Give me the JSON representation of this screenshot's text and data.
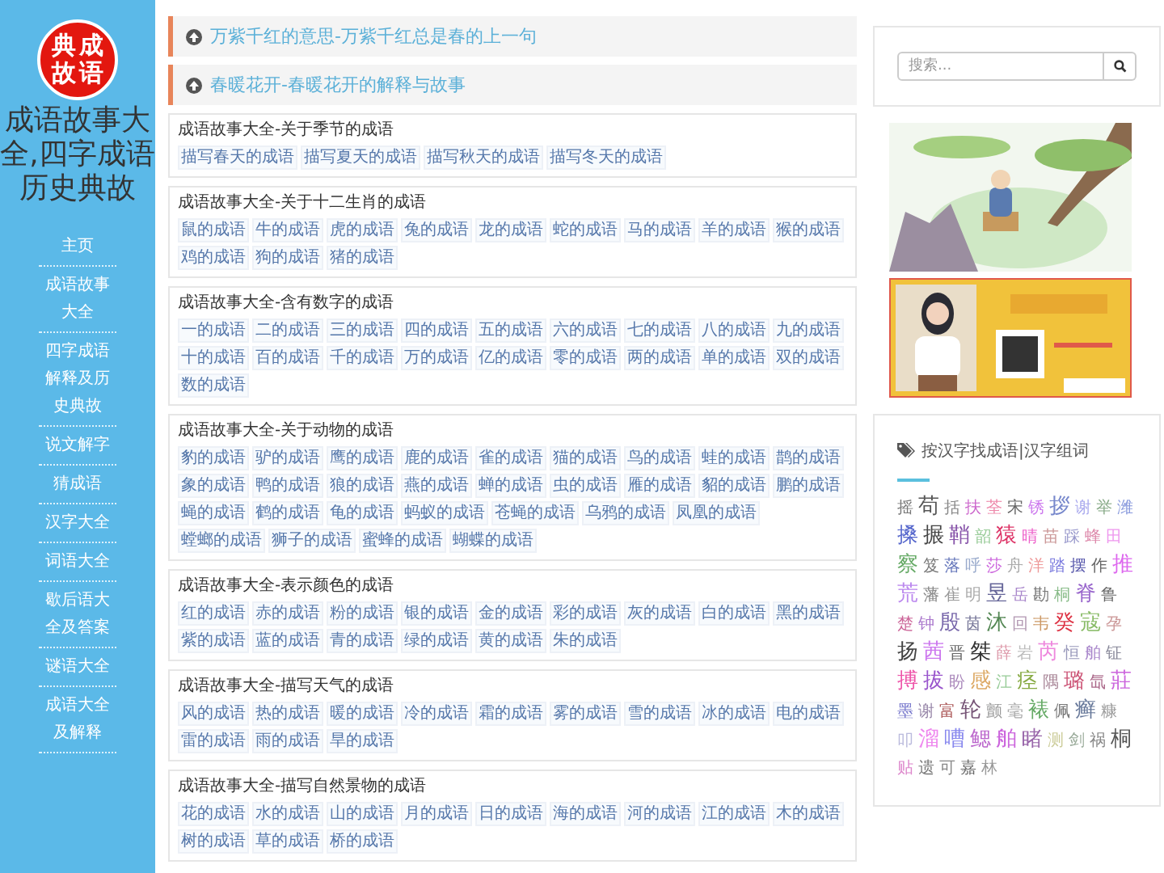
{
  "logo": {
    "chars": [
      "典",
      "成",
      "故",
      "语"
    ]
  },
  "site_title": "成语故事大全,四字成语历史典故",
  "nav": [
    "主页",
    "成语故事大全",
    "四字成语解释及历史典故",
    "说文解字",
    "猜成语",
    "汉字大全",
    "词语大全",
    "歇后语大全及答案",
    "谜语大全",
    "成语大全及解释"
  ],
  "featured": [
    "万紫千红的意思-万紫千红总是春的上一句",
    "春暖花开-春暖花开的解释与故事"
  ],
  "sections": [
    {
      "title": "成语故事大全-关于季节的成语",
      "tags": [
        "描写春天的成语",
        "描写夏天的成语",
        "描写秋天的成语",
        "描写冬天的成语"
      ]
    },
    {
      "title": "成语故事大全-关于十二生肖的成语",
      "tags": [
        "鼠的成语",
        "牛的成语",
        "虎的成语",
        "兔的成语",
        "龙的成语",
        "蛇的成语",
        "马的成语",
        "羊的成语",
        "猴的成语",
        "鸡的成语",
        "狗的成语",
        "猪的成语"
      ]
    },
    {
      "title": "成语故事大全-含有数字的成语",
      "tags": [
        "一的成语",
        "二的成语",
        "三的成语",
        "四的成语",
        "五的成语",
        "六的成语",
        "七的成语",
        "八的成语",
        "九的成语",
        "十的成语",
        "百的成语",
        "千的成语",
        "万的成语",
        "亿的成语",
        "零的成语",
        "两的成语",
        "单的成语",
        "双的成语",
        "数的成语"
      ]
    },
    {
      "title": "成语故事大全-关于动物的成语",
      "tags": [
        "豹的成语",
        "驴的成语",
        "鹰的成语",
        "鹿的成语",
        "雀的成语",
        "猫的成语",
        "鸟的成语",
        "蛙的成语",
        "鹊的成语",
        "象的成语",
        "鸭的成语",
        "狼的成语",
        "燕的成语",
        "蝉的成语",
        "虫的成语",
        "雁的成语",
        "貂的成语",
        "鹏的成语",
        "蝇的成语",
        "鹤的成语",
        "龟的成语",
        "蚂蚁的成语",
        "苍蝇的成语",
        "乌鸦的成语",
        "凤凰的成语",
        "螳螂的成语",
        "狮子的成语",
        "蜜蜂的成语",
        "蝴蝶的成语"
      ]
    },
    {
      "title": "成语故事大全-表示颜色的成语",
      "tags": [
        "红的成语",
        "赤的成语",
        "粉的成语",
        "银的成语",
        "金的成语",
        "彩的成语",
        "灰的成语",
        "白的成语",
        "黑的成语",
        "紫的成语",
        "蓝的成语",
        "青的成语",
        "绿的成语",
        "黄的成语",
        "朱的成语"
      ]
    },
    {
      "title": "成语故事大全-描写天气的成语",
      "tags": [
        "风的成语",
        "热的成语",
        "暖的成语",
        "冷的成语",
        "霜的成语",
        "雾的成语",
        "雪的成语",
        "冰的成语",
        "电的成语",
        "雷的成语",
        "雨的成语",
        "旱的成语"
      ]
    },
    {
      "title": "成语故事大全-描写自然景物的成语",
      "tags": [
        "花的成语",
        "水的成语",
        "山的成语",
        "月的成语",
        "日的成语",
        "海的成语",
        "河的成语",
        "江的成语",
        "木的成语",
        "树的成语",
        "草的成语",
        "桥的成语"
      ]
    }
  ],
  "search": {
    "placeholder": "搜索..."
  },
  "cloud": {
    "title": "按汉字找成语|汉字组词",
    "tags": [
      {
        "text": "摇",
        "color": "#777777",
        "kind": "small"
      },
      {
        "text": "苟",
        "color": "#555555",
        "kind": "big"
      },
      {
        "text": "括",
        "color": "#888888",
        "kind": "small"
      },
      {
        "text": "扶",
        "color": "#cc66cc",
        "kind": "small"
      },
      {
        "text": "荃",
        "color": "#ee88aa",
        "kind": "small"
      },
      {
        "text": "宋",
        "color": "#666666",
        "kind": "small"
      },
      {
        "text": "锈",
        "color": "#cc77ee",
        "kind": "small"
      },
      {
        "text": "拶",
        "color": "#7788cc",
        "kind": "big"
      },
      {
        "text": "谢",
        "color": "#aaaaee",
        "kind": "small"
      },
      {
        "text": "举",
        "color": "#88aa88",
        "kind": "small"
      },
      {
        "text": "潍",
        "color": "#8899dd",
        "kind": "small"
      },
      {
        "text": "搡",
        "color": "#5566cc",
        "kind": "big"
      },
      {
        "text": "搌",
        "color": "#444444",
        "kind": "big"
      },
      {
        "text": "鞘",
        "color": "#8855aa",
        "kind": "big"
      },
      {
        "text": "韶",
        "color": "#99cc99",
        "kind": "small"
      },
      {
        "text": "猿",
        "color": "#dd3366",
        "kind": "big"
      },
      {
        "text": "晴",
        "color": "#ee66cc",
        "kind": "small"
      },
      {
        "text": "苗",
        "color": "#cc9999",
        "kind": "small"
      },
      {
        "text": "踩",
        "color": "#9999cc",
        "kind": "small"
      },
      {
        "text": "蜂",
        "color": "#dd88aa",
        "kind": "small"
      },
      {
        "text": "田",
        "color": "#ee99ee",
        "kind": "small"
      },
      {
        "text": "察",
        "color": "#66aa66",
        "kind": "big"
      },
      {
        "text": "笈",
        "color": "#777777",
        "kind": "small"
      },
      {
        "text": "落",
        "color": "#6677bb",
        "kind": "small"
      },
      {
        "text": "呼",
        "color": "#99aacc",
        "kind": "small"
      },
      {
        "text": "莎",
        "color": "#cc66dd",
        "kind": "small"
      },
      {
        "text": "舟",
        "color": "#aaaaaa",
        "kind": "small"
      },
      {
        "text": "洋",
        "color": "#ee9999",
        "kind": "small"
      },
      {
        "text": "踏",
        "color": "#7777dd",
        "kind": "small"
      },
      {
        "text": "摆",
        "color": "#5555aa",
        "kind": "small"
      },
      {
        "text": "作",
        "color": "#666666",
        "kind": "small"
      },
      {
        "text": "推",
        "color": "#dd66ee",
        "kind": "big"
      },
      {
        "text": "荒",
        "color": "#bb88ee",
        "kind": "big"
      },
      {
        "text": "藩",
        "color": "#888888",
        "kind": "small"
      },
      {
        "text": "崔",
        "color": "#999999",
        "kind": "small"
      },
      {
        "text": "明",
        "color": "#aaaaaa",
        "kind": "small"
      },
      {
        "text": "昱",
        "color": "#666699",
        "kind": "big"
      },
      {
        "text": "岳",
        "color": "#aa88cc",
        "kind": "small"
      },
      {
        "text": "勘",
        "color": "#777777",
        "kind": "small"
      },
      {
        "text": "桐",
        "color": "#88bb88",
        "kind": "small"
      },
      {
        "text": "脊",
        "color": "#9966cc",
        "kind": "big"
      },
      {
        "text": "鲁",
        "color": "#666666",
        "kind": "small"
      },
      {
        "text": "楚",
        "color": "#cc6699",
        "kind": "small"
      },
      {
        "text": "钟",
        "color": "#aa77cc",
        "kind": "small"
      },
      {
        "text": "殷",
        "color": "#7766aa",
        "kind": "big"
      },
      {
        "text": "茵",
        "color": "#777799",
        "kind": "small"
      },
      {
        "text": "沐",
        "color": "#558855",
        "kind": "big"
      },
      {
        "text": "回",
        "color": "#b399b3",
        "kind": "small"
      },
      {
        "text": "韦",
        "color": "#cc9966",
        "kind": "small"
      },
      {
        "text": "癸",
        "color": "#dd3344",
        "kind": "big"
      },
      {
        "text": "寇",
        "color": "#88bb66",
        "kind": "big"
      },
      {
        "text": "孕",
        "color": "#cc9999",
        "kind": "small"
      },
      {
        "text": "扬",
        "color": "#444444",
        "kind": "big"
      },
      {
        "text": "茜",
        "color": "#cc77ee",
        "kind": "big"
      },
      {
        "text": "晋",
        "color": "#666666",
        "kind": "small"
      },
      {
        "text": "桀",
        "color": "#333333",
        "kind": "big"
      },
      {
        "text": "薛",
        "color": "#dd99aa",
        "kind": "small"
      },
      {
        "text": "岩",
        "color": "#bbbbbb",
        "kind": "small"
      },
      {
        "text": "芮",
        "color": "#ee88dd",
        "kind": "big"
      },
      {
        "text": "恒",
        "color": "#9999bb",
        "kind": "small"
      },
      {
        "text": "舶",
        "color": "#aa88cc",
        "kind": "small"
      },
      {
        "text": "钲",
        "color": "#888899",
        "kind": "small"
      },
      {
        "text": "搏",
        "color": "#ee55aa",
        "kind": "big"
      },
      {
        "text": "拔",
        "color": "#9955cc",
        "kind": "big"
      },
      {
        "text": "盼",
        "color": "#aa88bb",
        "kind": "small"
      },
      {
        "text": "感",
        "color": "#ddaa66",
        "kind": "big"
      },
      {
        "text": "江",
        "color": "#99cc99",
        "kind": "small"
      },
      {
        "text": "痉",
        "color": "#88aa44",
        "kind": "big"
      },
      {
        "text": "隅",
        "color": "#aa8899",
        "kind": "small"
      },
      {
        "text": "璐",
        "color": "#cc5577",
        "kind": "big"
      },
      {
        "text": "氙",
        "color": "#aa6688",
        "kind": "small"
      },
      {
        "text": "莊",
        "color": "#cc66dd",
        "kind": "big"
      },
      {
        "text": "墨",
        "color": "#7777cc",
        "kind": "small"
      },
      {
        "text": "谢",
        "color": "#9988aa",
        "kind": "small"
      },
      {
        "text": "富",
        "color": "#aa5555",
        "kind": "small"
      },
      {
        "text": "轮",
        "color": "#775577",
        "kind": "big"
      },
      {
        "text": "颤",
        "color": "#999999",
        "kind": "small"
      },
      {
        "text": "毫",
        "color": "#aaaaaa",
        "kind": "small"
      },
      {
        "text": "裱",
        "color": "#66aa66",
        "kind": "big"
      },
      {
        "text": "佩",
        "color": "#777777",
        "kind": "small"
      },
      {
        "text": "癣",
        "color": "#667799",
        "kind": "big"
      },
      {
        "text": "糠",
        "color": "#999999",
        "kind": "small"
      },
      {
        "text": "叩",
        "color": "#bbbbdd",
        "kind": "small"
      },
      {
        "text": "溜",
        "color": "#ee88ee",
        "kind": "big"
      },
      {
        "text": "嘈",
        "color": "#8888ee",
        "kind": "big"
      },
      {
        "text": "鳃",
        "color": "#bb66cc",
        "kind": "big"
      },
      {
        "text": "舶",
        "color": "#cc66dd",
        "kind": "big"
      },
      {
        "text": "睹",
        "color": "#9966aa",
        "kind": "big"
      },
      {
        "text": "测",
        "color": "#cccc99",
        "kind": "small"
      },
      {
        "text": "剑",
        "color": "#99aa99",
        "kind": "small"
      },
      {
        "text": "祸",
        "color": "#888888",
        "kind": "small"
      },
      {
        "text": "桐",
        "color": "#555555",
        "kind": "big"
      },
      {
        "text": "贴",
        "color": "#dd88cc",
        "kind": "small"
      },
      {
        "text": "遗",
        "color": "#777777",
        "kind": "small"
      },
      {
        "text": "可",
        "color": "#888888",
        "kind": "small"
      },
      {
        "text": "嘉",
        "color": "#666666",
        "kind": "small"
      },
      {
        "text": "林",
        "color": "#999999",
        "kind": "small"
      }
    ]
  }
}
